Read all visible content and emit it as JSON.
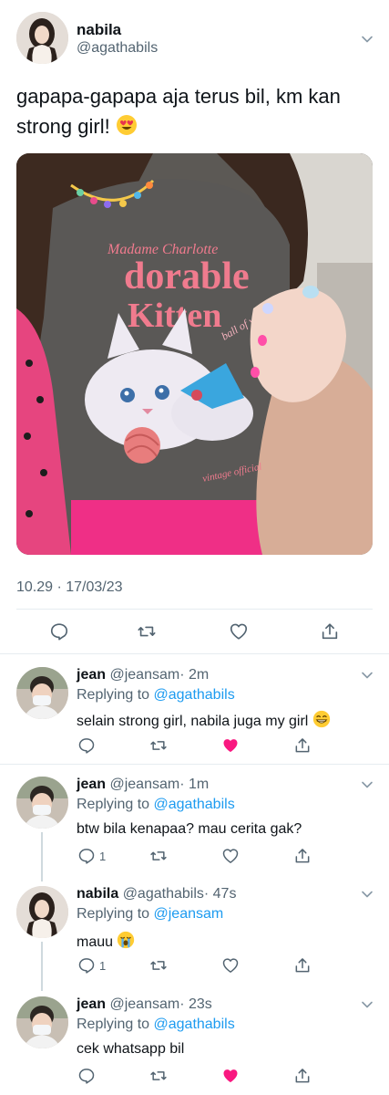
{
  "main_tweet": {
    "author_name": "nabila",
    "author_handle": "@agathabils",
    "text": "gapapa-gapapa aja terus bil, km kan strong girl!",
    "emoji": "heart-eyes-emoji",
    "photo_text_1": "Madame Charlotte",
    "photo_text_2": "dorable",
    "photo_text_3": "Kitten",
    "photo_text_4": "ball of yarn",
    "photo_text_5": "vintage official",
    "timestamp": "10.29 · 17/03/23"
  },
  "replies": [
    {
      "name": "jean",
      "handle": "@jeansam",
      "time": "· 2m",
      "replying_prefix": "Replying to",
      "replying_to": "@agathabils",
      "text": "selain strong girl, nabila juga my girl",
      "emoji": "grin-emoji",
      "reply_count": "",
      "liked": true
    },
    {
      "name": "jean",
      "handle": "@jeansam",
      "time": "· 1m",
      "replying_prefix": "Replying to",
      "replying_to": "@agathabils",
      "text": "btw bila kenapaa? mau cerita gak?",
      "emoji": "",
      "reply_count": "1",
      "liked": false
    },
    {
      "name": "nabila",
      "handle": "@agathabils",
      "time": "· 47s",
      "replying_prefix": "Replying to",
      "replying_to": "@jeansam",
      "text": "mauu",
      "emoji": "loudly-crying-emoji",
      "reply_count": "1",
      "liked": false
    },
    {
      "name": "jean",
      "handle": "@jeansam",
      "time": "· 23s",
      "replying_prefix": "Replying to",
      "replying_to": "@agathabils",
      "text": "cek whatsapp bil",
      "emoji": "",
      "reply_count": "",
      "liked": true
    }
  ],
  "colors": {
    "accent": "#1d9bf0",
    "like_red": "#f91880",
    "muted": "#536471",
    "divider": "#e6ecf0"
  }
}
